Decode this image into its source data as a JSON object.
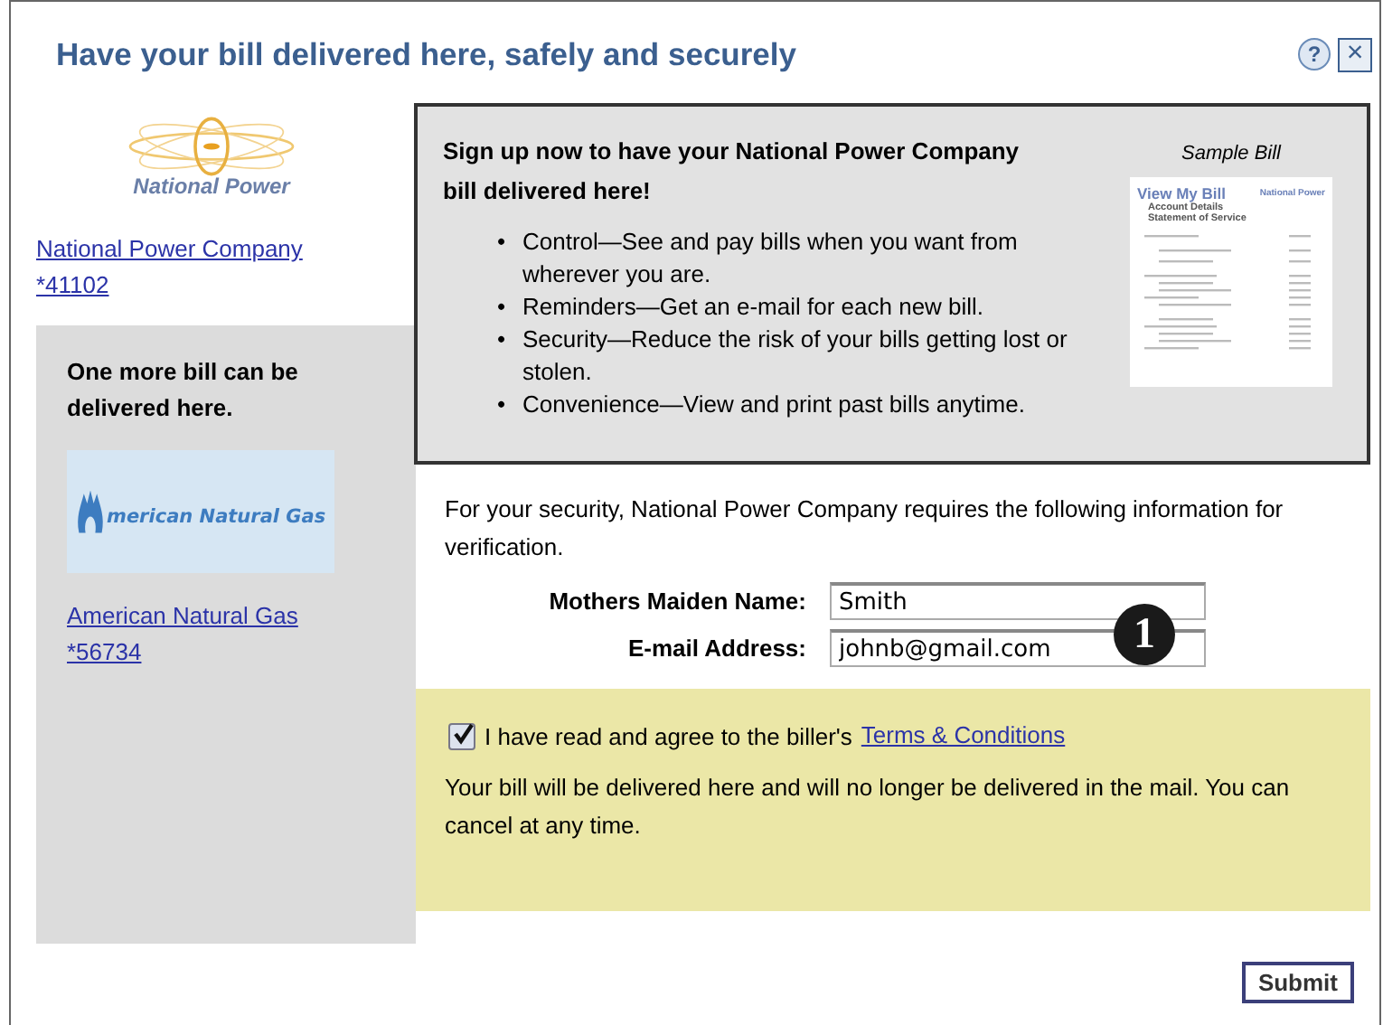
{
  "window": {
    "title": "Have your bill delivered here, safely and securely",
    "help": "?",
    "close": "×"
  },
  "biller": {
    "logo_text": "National Power",
    "name": "National Power Company",
    "account": "*41102"
  },
  "more_panel": {
    "heading": "One more bill can be delivered here.",
    "logo_text": "merican Natural Gas",
    "name": "American Natural Gas",
    "account": "*56734"
  },
  "promo": {
    "heading": "Sign up now to have your National Power Company bill delivered here!",
    "bullet_marker": "•",
    "bullets": [
      "Control—See and pay bills when you want from wherever you are.",
      "Reminders—Get an e-mail for each new bill.",
      "Security—Reduce the risk of your bills getting lost or stolen.",
      "Convenience—View and print past bills anytime."
    ],
    "sample": {
      "caption": "Sample Bill",
      "title": "View My Bill",
      "subtitle_1": "Account Details",
      "subtitle_2": "Statement of Service",
      "logo_text": "National Power"
    }
  },
  "verification": {
    "intro": "For your security, National Power Company requires the following information for verification.",
    "fields": [
      {
        "label": "Mothers Maiden Name:",
        "value": "Smith"
      },
      {
        "label": "E-mail Address:",
        "value": "johnb@gmail.com"
      }
    ],
    "callout": "1"
  },
  "agreement": {
    "checked": true,
    "text": "I have read and agree to the biller's",
    "link": "Terms & Conditions",
    "note": "Your bill will be delivered here and will no longer be delivered in the mail. You can cancel at any time."
  },
  "submit": "Submit"
}
